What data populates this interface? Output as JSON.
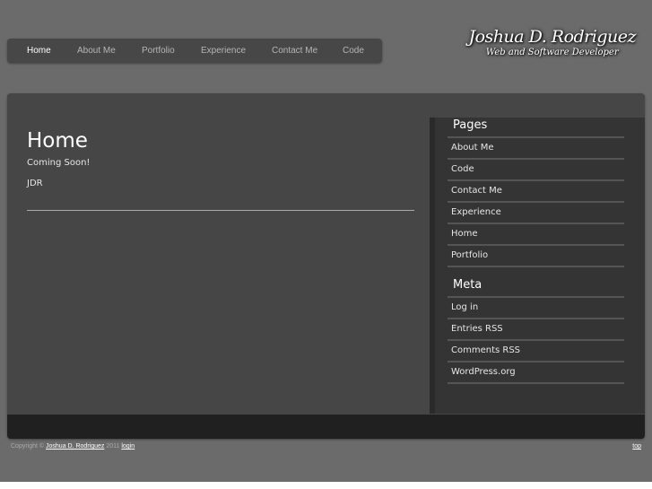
{
  "nav": {
    "items": [
      "Home",
      "About Me",
      "Portfolio",
      "Experience",
      "Contact Me",
      "Code"
    ],
    "active": "Home"
  },
  "brand": {
    "name": "Joshua D. Rodriguez",
    "tagline": "Web and Software Developer"
  },
  "content": {
    "title": "Home",
    "paragraphs": [
      "Coming Soon!",
      "JDR"
    ]
  },
  "sidebar": {
    "pages_title": "Pages",
    "pages": [
      "About Me",
      "Code",
      "Contact Me",
      "Experience",
      "Home",
      "Portfolio"
    ],
    "meta_title": "Meta",
    "meta": [
      "Log in",
      "Entries RSS",
      "Comments RSS",
      "WordPress.org"
    ]
  },
  "footer": {
    "copyright": "Copyright ©",
    "author": "Joshua D. Rodriguez",
    "year": "2011",
    "login": "login",
    "top": "top"
  }
}
